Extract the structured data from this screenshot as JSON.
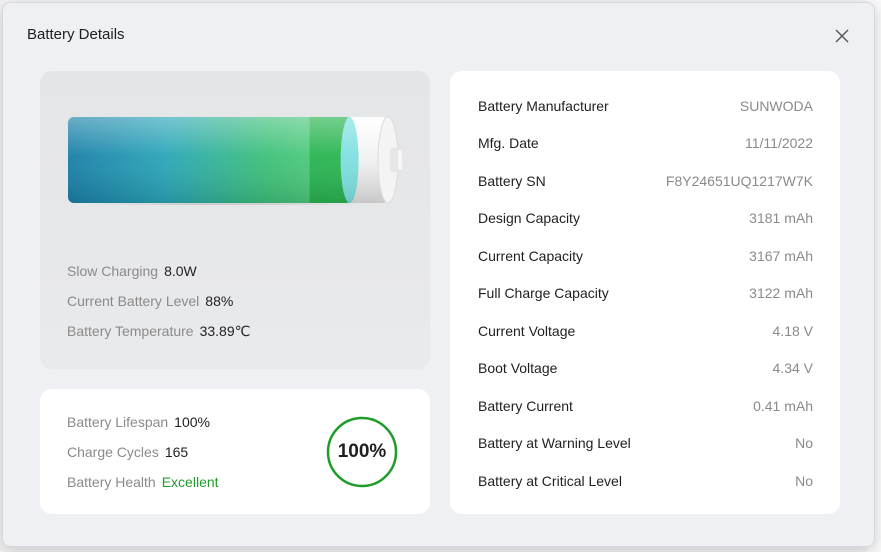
{
  "dialog": {
    "title": "Battery Details"
  },
  "colors": {
    "accent_green": "#1f9d2a",
    "label_gray": "#8a8a8a",
    "text_dark": "#1f1f1f"
  },
  "charging": {
    "rows": [
      {
        "label": "Slow Charging",
        "value": "8.0W"
      },
      {
        "label": "Current Battery Level",
        "value": "88%"
      },
      {
        "label": "Battery Temperature",
        "value": "33.89℃"
      }
    ],
    "level_fraction": 0.88
  },
  "health": {
    "rows": [
      {
        "label": "Battery Lifespan",
        "value": "100%"
      },
      {
        "label": "Charge Cycles",
        "value": "165"
      },
      {
        "label": "Battery Health",
        "value": "Excellent"
      }
    ],
    "ring_value": "100%",
    "ring_fraction": 1.0
  },
  "info": {
    "rows": [
      {
        "label": "Battery Manufacturer",
        "value": "SUNWODA"
      },
      {
        "label": "Mfg. Date",
        "value": "11/11/2022"
      },
      {
        "label": "Battery SN",
        "value": "F8Y24651UQ1217W7K"
      },
      {
        "label": "Design Capacity",
        "value": "3181 mAh"
      },
      {
        "label": "Current Capacity",
        "value": "3167 mAh"
      },
      {
        "label": "Full Charge Capacity",
        "value": "3122 mAh"
      },
      {
        "label": "Current Voltage",
        "value": "4.18 V"
      },
      {
        "label": "Boot Voltage",
        "value": "4.34 V"
      },
      {
        "label": "Battery Current",
        "value": "0.41 mAh"
      },
      {
        "label": "Battery at Warning Level",
        "value": "No"
      },
      {
        "label": "Battery at Critical Level",
        "value": "No"
      }
    ]
  },
  "icons": {
    "close": "close-icon",
    "battery": "battery-icon"
  }
}
